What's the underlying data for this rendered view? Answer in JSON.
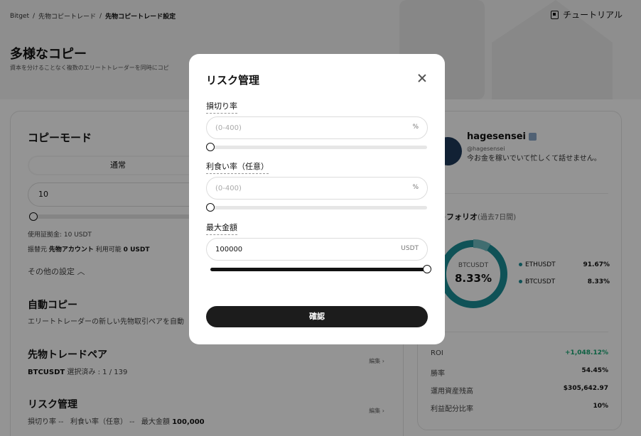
{
  "breadcrumb": [
    "Bitget",
    "先物コピートレード",
    "先物コピートレード設定"
  ],
  "breadcrumb_sep": "/",
  "header": {
    "tutorial_label": "チュートリアル"
  },
  "hero": {
    "title": "多様なコピー",
    "subtitle": "資本を分けることなく複数のエリートトレーダーを同時にコピ"
  },
  "left_card": {
    "copy_mode_title": "コピーモード",
    "mode_tab_active": "通常",
    "amount_value": "10",
    "margin_text": "使用証拠金: 10 USDT",
    "account_label": "振替元",
    "account_value": "先物アカウント",
    "available_label": "利用可能",
    "available_value": "0 USDT",
    "more_settings": "その他の設定",
    "auto_copy_title": "自動コピー",
    "auto_copy_desc": "エリートトレーダーの新しい先物取引ペアを自動",
    "pairs_title": "先物トレードペア",
    "pairs_symbol": "BTCUSDT",
    "pairs_desc": "選択済み : 1 / 139",
    "edit_label": "編集",
    "risk_title": "リスク管理",
    "risk_stop_loss": "損切り率 --",
    "risk_take_profit": "利食い率（任意） --",
    "risk_max_label": "最大金額",
    "risk_max_value": "100,000"
  },
  "right_card": {
    "trader_name": "hagesensei",
    "trader_handle": "@hagesensei",
    "trader_bio": "今お金を稼いでいて忙しくて話せません。",
    "portfolio_label": "ートフォリオ",
    "portfolio_period": "(過去7日間)",
    "donut_center_label": "BTCUSDT",
    "donut_center_value": "8.33%",
    "donut_color": "#1b8d97",
    "legend": [
      {
        "name": "ETHUSDT",
        "value": "91.67%"
      },
      {
        "name": "BTCUSDT",
        "value": "8.33%"
      }
    ],
    "stats": [
      {
        "label": "ROI",
        "value": "+1,048.12%"
      },
      {
        "label": "勝率",
        "value": "54.45%"
      },
      {
        "label": "運用資産残高",
        "value": "$305,642.97"
      },
      {
        "label": "利益配分比率",
        "value": "10%"
      }
    ]
  },
  "modal": {
    "title": "リスク管理",
    "stop_loss_label": "損切り率",
    "stop_loss_placeholder": "(0-400)",
    "stop_loss_unit": "%",
    "stop_loss_slider": 0,
    "take_profit_label": "利食い率（任意）",
    "take_profit_placeholder": "(0-400)",
    "take_profit_unit": "%",
    "take_profit_slider": 0,
    "max_amount_label": "最大金額",
    "max_amount_value": "100000",
    "max_amount_unit": "USDT",
    "max_amount_slider": 1,
    "confirm_label": "確認"
  }
}
